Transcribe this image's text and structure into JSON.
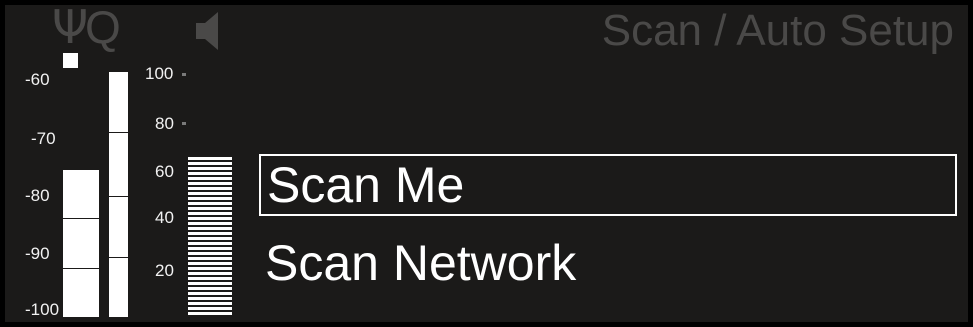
{
  "header": {
    "antenna_icon": "antenna-icon",
    "antenna_glyph": "Ψ",
    "q_glyph": "Q",
    "speaker_icon": "speaker-icon",
    "title": "Scan / Auto Setup"
  },
  "rf_meter": {
    "labels": [
      "-60",
      "-70",
      "-80",
      "-90",
      "-100"
    ],
    "level": 0.6
  },
  "level_meter": {
    "labels": [
      "100",
      "80",
      "60",
      "40",
      "20"
    ],
    "level": 0.65
  },
  "menu": {
    "items": [
      {
        "label": "Scan Me",
        "selected": true
      },
      {
        "label": "Scan Network",
        "selected": false
      }
    ]
  },
  "colors": {
    "background": "#1b1a19",
    "dim_text": "#4a4948",
    "highlight": "#ffffff"
  }
}
